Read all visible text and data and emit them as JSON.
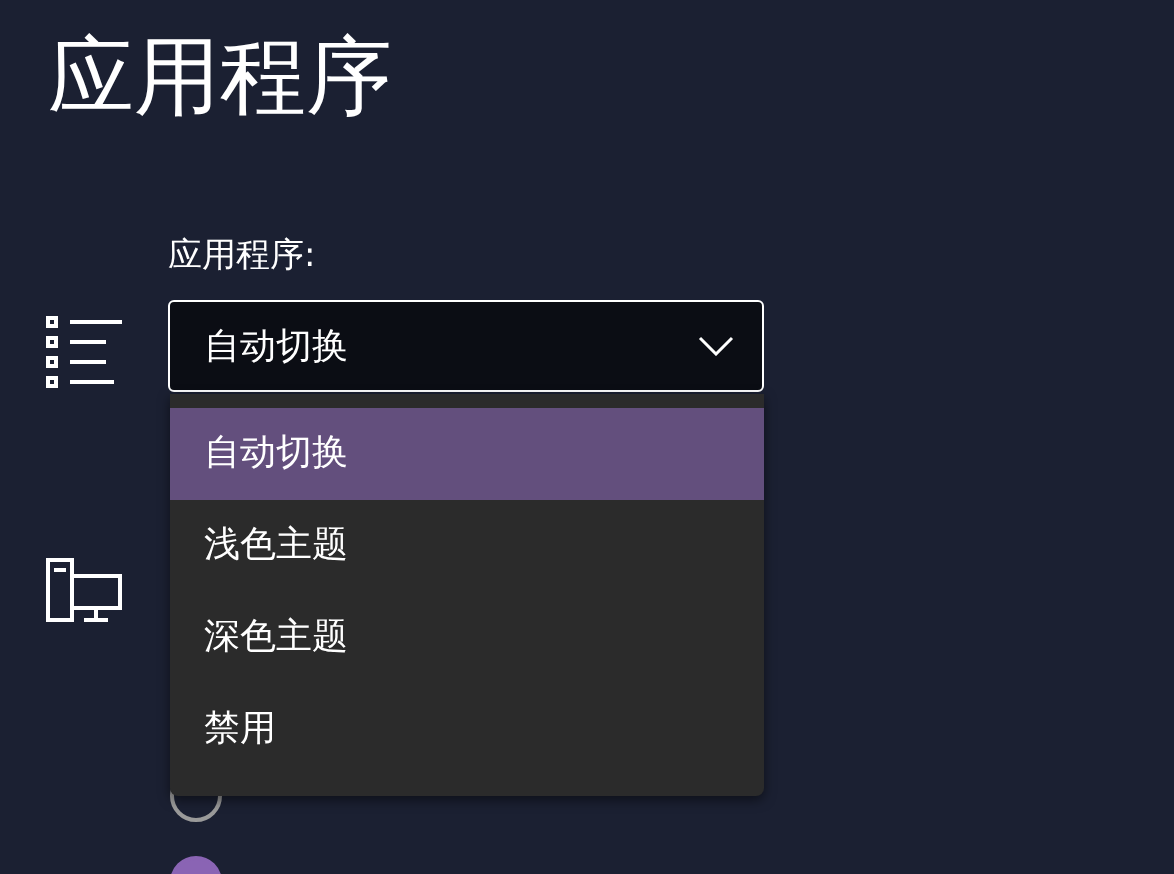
{
  "title": "应用程序",
  "app_dropdown": {
    "label": "应用程序:",
    "value": "自动切换",
    "expanded": true,
    "options": [
      {
        "label": "自动切换",
        "selected": true
      },
      {
        "label": "浅色主题",
        "selected": false
      },
      {
        "label": "深色主题",
        "selected": false
      },
      {
        "label": "禁用",
        "selected": false
      }
    ]
  },
  "theme_radios": [
    {
      "selected": false
    },
    {
      "selected": true
    }
  ]
}
